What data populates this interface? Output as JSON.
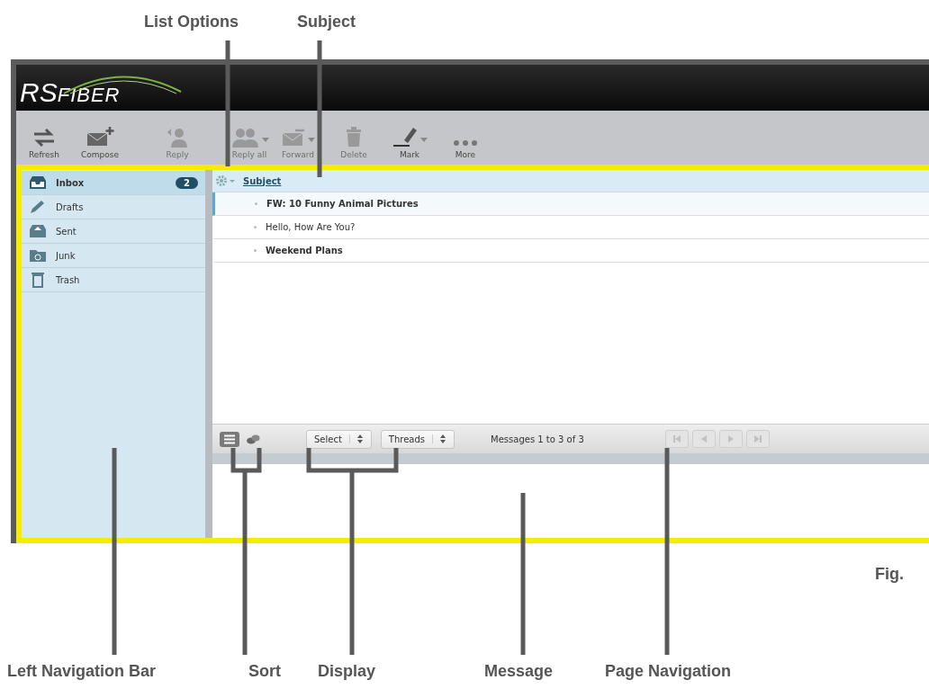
{
  "annotations_top": [
    {
      "label": "List Options"
    },
    {
      "label": "Subject"
    }
  ],
  "app": {
    "logo": {
      "prefix": "RS",
      "suffix": "FIBER"
    },
    "toolbar": [
      {
        "kind": "refresh",
        "label": "Refresh",
        "disabled": false,
        "menu": false
      },
      {
        "kind": "compose",
        "label": "Compose",
        "disabled": false,
        "menu": false
      },
      {
        "kind": "reply",
        "label": "Reply",
        "disabled": true,
        "menu": false
      },
      {
        "kind": "reply_all",
        "label": "Reply all",
        "disabled": true,
        "menu": true
      },
      {
        "kind": "forward",
        "label": "Forward",
        "disabled": true,
        "menu": true
      },
      {
        "kind": "delete",
        "label": "Delete",
        "disabled": true,
        "menu": false
      },
      {
        "kind": "mark",
        "label": "Mark",
        "disabled": false,
        "menu": true
      },
      {
        "kind": "more",
        "label": "More",
        "disabled": false,
        "menu": false
      }
    ],
    "folders": [
      {
        "kind": "inbox",
        "name": "Inbox",
        "selected": true,
        "badge": "2"
      },
      {
        "kind": "drafts",
        "name": "Drafts",
        "selected": false
      },
      {
        "kind": "sent",
        "name": "Sent",
        "selected": false
      },
      {
        "kind": "junk",
        "name": "Junk",
        "selected": false
      },
      {
        "kind": "trash",
        "name": "Trash",
        "selected": false
      }
    ],
    "list": {
      "column": "Subject",
      "rows": [
        {
          "subject": "FW: 10 Funny Animal Pictures",
          "unread": true,
          "selected": true
        },
        {
          "subject": "Hello, How Are You?",
          "unread": false,
          "selected": false
        },
        {
          "subject": "Weekend Plans",
          "unread": true,
          "selected": false
        }
      ]
    },
    "footer": {
      "views": [
        {
          "kind": "list",
          "selected": true
        },
        {
          "kind": "threads",
          "selected": false
        }
      ],
      "selects": [
        "Select",
        "Threads"
      ],
      "status": "Messages 1 to 3 of 3",
      "pager": [
        {
          "kind": "first",
          "disabled": true
        },
        {
          "kind": "prev",
          "disabled": true
        },
        {
          "kind": "next",
          "disabled": true
        },
        {
          "kind": "last",
          "disabled": true
        }
      ]
    }
  },
  "figure_label": "Fig.",
  "annotations_bottom": [
    {
      "label": "Left Navigation Bar"
    },
    {
      "label": "Sort"
    },
    {
      "label": "Display"
    },
    {
      "label": "Message"
    },
    {
      "label": "Page Navigation"
    }
  ]
}
